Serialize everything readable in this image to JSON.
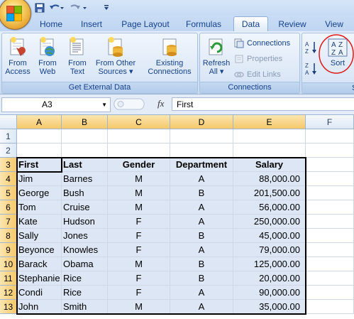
{
  "quick_access": {
    "save": "save-icon",
    "undo": "undo-icon",
    "redo": "redo-icon"
  },
  "tabs": [
    {
      "label": "Home",
      "active": false
    },
    {
      "label": "Insert",
      "active": false
    },
    {
      "label": "Page Layout",
      "active": false
    },
    {
      "label": "Formulas",
      "active": false
    },
    {
      "label": "Data",
      "active": true
    },
    {
      "label": "Review",
      "active": false
    },
    {
      "label": "View",
      "active": false
    }
  ],
  "ribbon": {
    "get_external": {
      "label": "Get External Data",
      "buttons": [
        {
          "line1": "From",
          "line2": "Access"
        },
        {
          "line1": "From",
          "line2": "Web"
        },
        {
          "line1": "From",
          "line2": "Text"
        },
        {
          "line1": "From Other",
          "line2": "Sources ▾"
        },
        {
          "line1": "Existing",
          "line2": "Connections"
        }
      ]
    },
    "connections": {
      "label": "Connections",
      "refresh_line1": "Refresh",
      "refresh_line2": "All ▾",
      "connections": "Connections",
      "properties": "Properties",
      "edit_links": "Edit Links"
    },
    "sort": {
      "label": "Sort",
      "sort_button": "Sort",
      "az": "A Z",
      "za": "Z A",
      "group_label_partial": "S"
    }
  },
  "formula_bar": {
    "name_box": "A3",
    "fx": "fx",
    "formula": "First"
  },
  "grid": {
    "columns": [
      "A",
      "B",
      "C",
      "D",
      "E",
      "F"
    ],
    "rows": [
      "1",
      "2",
      "3",
      "4",
      "5",
      "6",
      "7",
      "8",
      "9",
      "10",
      "11",
      "12",
      "13"
    ],
    "header": [
      "First",
      "Last",
      "Gender",
      "Department",
      "Salary"
    ],
    "data": [
      [
        "Jim",
        "Barnes",
        "M",
        "A",
        "88,000.00"
      ],
      [
        "George",
        "Bush",
        "M",
        "B",
        "201,500.00"
      ],
      [
        "Tom",
        "Cruise",
        "M",
        "A",
        "56,000.00"
      ],
      [
        "Kate",
        "Hudson",
        "F",
        "A",
        "250,000.00"
      ],
      [
        "Sally",
        "Jones",
        "F",
        "B",
        "45,000.00"
      ],
      [
        "Beyonce",
        "Knowles",
        "F",
        "A",
        "79,000.00"
      ],
      [
        "Barack",
        "Obama",
        "M",
        "B",
        "125,000.00"
      ],
      [
        "Stephanie",
        "Rice",
        "F",
        "B",
        "20,000.00"
      ],
      [
        "Condi",
        "Rice",
        "F",
        "A",
        "90,000.00"
      ],
      [
        "John",
        "Smith",
        "M",
        "A",
        "35,000.00"
      ]
    ]
  }
}
